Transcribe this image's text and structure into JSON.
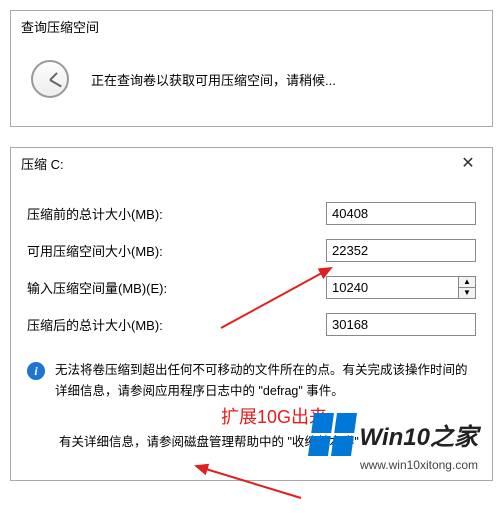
{
  "query_dialog": {
    "title": "查询压缩空间",
    "message": "正在查询卷以获取可用压缩空间，请稍候..."
  },
  "shrink_dialog": {
    "title": "压缩 C:",
    "close": "✕",
    "fields": {
      "total_before_label": "压缩前的总计大小(MB):",
      "total_before_value": "40408",
      "available_label": "可用压缩空间大小(MB):",
      "available_value": "22352",
      "input_label": "输入压缩空间量(MB)(E):",
      "input_value": "10240",
      "total_after_label": "压缩后的总计大小(MB):",
      "total_after_value": "30168"
    },
    "info_text": "无法将卷压缩到超出任何不可移动的文件所在的点。有关完成该操作时间的详细信息，请参阅应用程序日志中的 \"defrag\" 事件。",
    "note_text": "有关详细信息，请参阅磁盘管理帮助中的 \"收缩基本卷\""
  },
  "annotation": "扩展10G出来",
  "branding": {
    "name": "Win10之家",
    "url": "www.win10xitong.com"
  }
}
